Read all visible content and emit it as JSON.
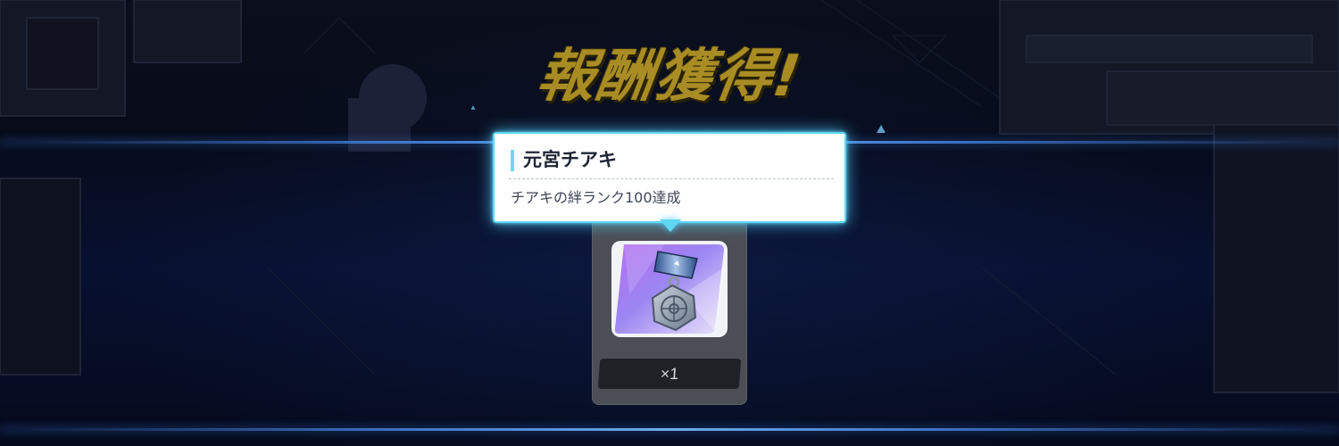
{
  "screen": {
    "title": "報酬獲得!",
    "accent_color": "#5fd6f2",
    "title_color": "#a98d24"
  },
  "reward": {
    "item_icon": "medal-icon",
    "quantity": "×1"
  },
  "tooltip": {
    "name": "元宮チアキ",
    "description": "チアキの絆ランク100達成"
  }
}
